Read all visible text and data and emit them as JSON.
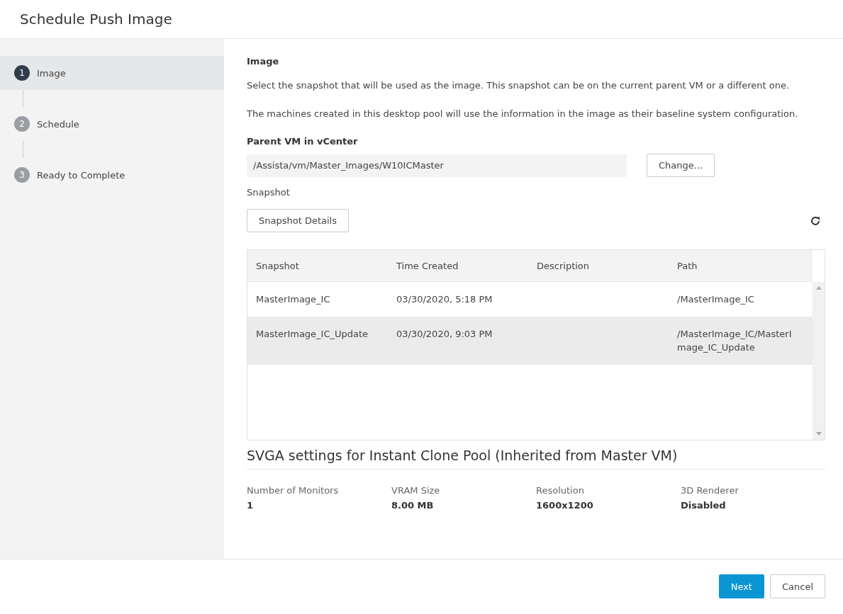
{
  "dialog": {
    "title": "Schedule Push Image"
  },
  "steps": [
    {
      "number": "1",
      "label": "Image",
      "selected": true
    },
    {
      "number": "2",
      "label": "Schedule",
      "selected": false
    },
    {
      "number": "3",
      "label": "Ready to Complete",
      "selected": false
    }
  ],
  "section": {
    "heading": "Image",
    "paragraphs": [
      "Select the snapshot that will be used as the image. This snapshot can be on the current parent VM or a different one.",
      "The machines created in this desktop pool will use the information in the image as their baseline system configuration."
    ]
  },
  "parent_vm": {
    "label": "Parent VM in vCenter",
    "value": "/Assista/vm/Master_Images/W10ICMaster",
    "button": "Change..."
  },
  "snapshot": {
    "label": "Snapshot",
    "details_button": "Snapshot Details"
  },
  "table": {
    "columns": [
      "Snapshot",
      "Time Created",
      "Description",
      "Path"
    ],
    "rows": [
      {
        "cells": [
          "MasterImage_IC",
          "03/30/2020, 5:18 PM",
          "",
          "/MasterImage_IC"
        ],
        "selected": false
      },
      {
        "cells": [
          "MasterImage_IC_Update",
          "03/30/2020, 9:03 PM",
          "",
          "/MasterImage_IC/MasterImage_IC_Update"
        ],
        "selected": true
      }
    ]
  },
  "svga": {
    "title": "SVGA settings for Instant Clone Pool (Inherited from Master VM)",
    "fields": [
      {
        "label": "Number of Monitors",
        "value": "1"
      },
      {
        "label": "VRAM Size",
        "value": "8.00 MB"
      },
      {
        "label": "Resolution",
        "value": "1600x1200"
      },
      {
        "label": "3D Renderer",
        "value": "Disabled"
      }
    ]
  },
  "footer": {
    "buttons": [
      {
        "label": "Next",
        "kind": "primary"
      },
      {
        "label": "Cancel",
        "kind": "secondary"
      }
    ]
  }
}
